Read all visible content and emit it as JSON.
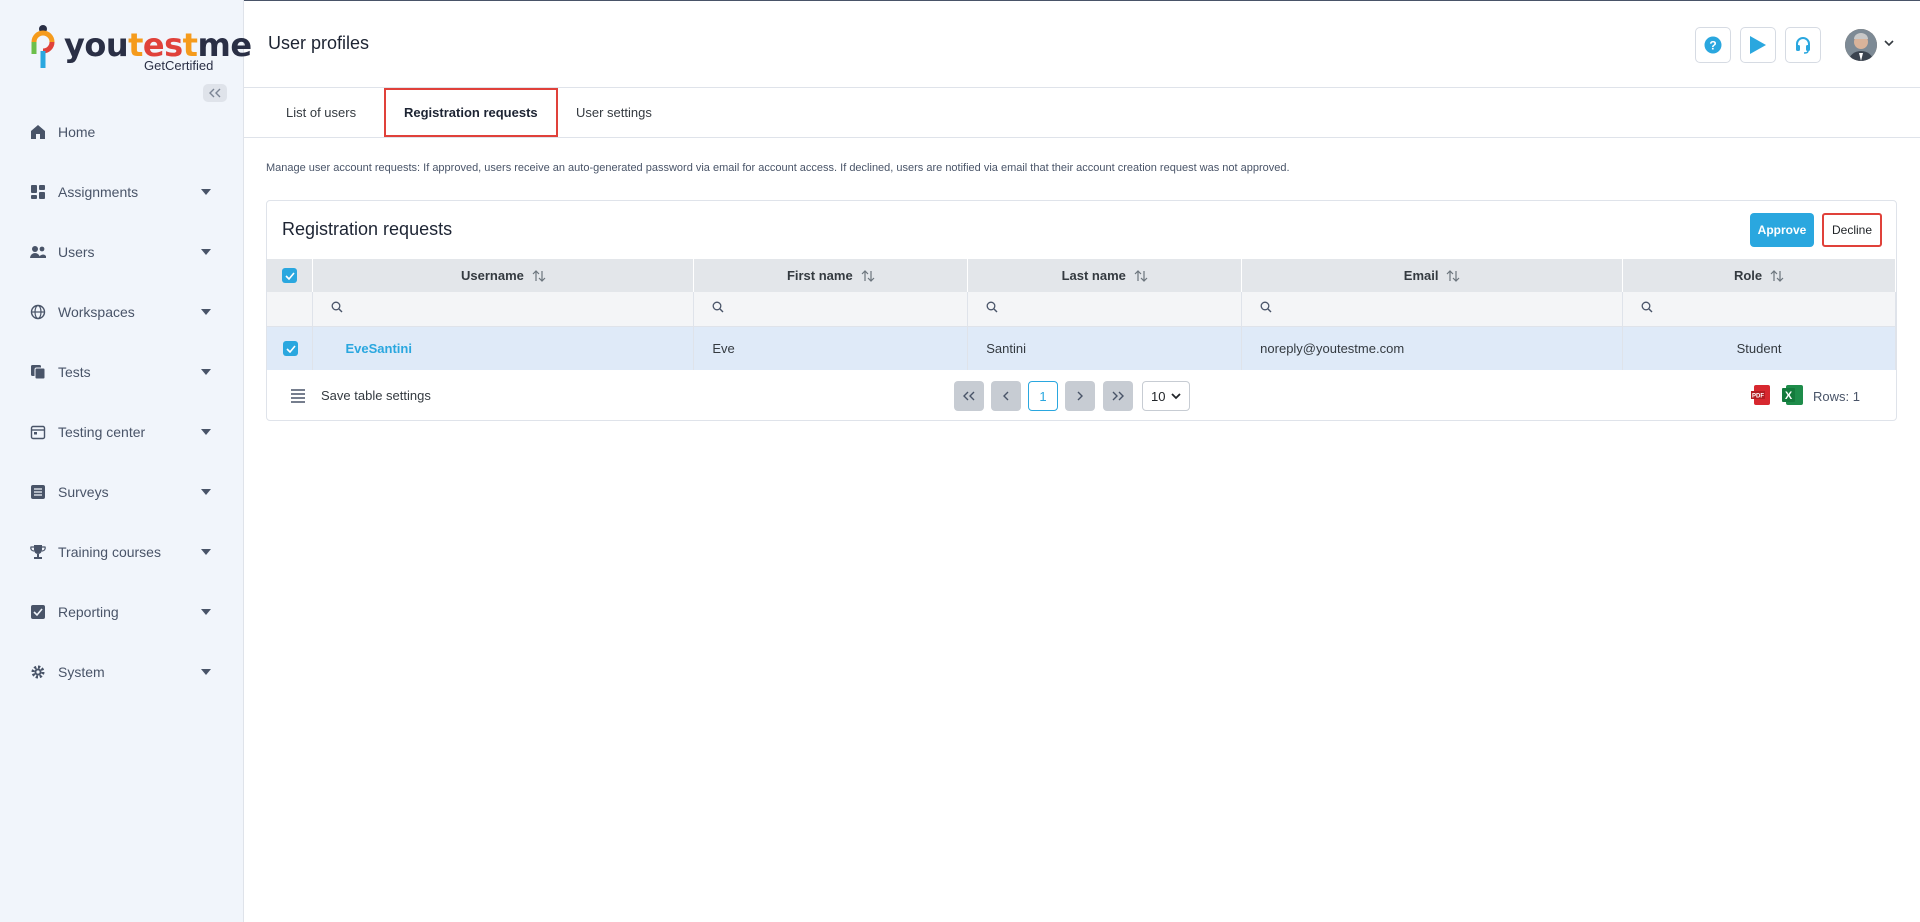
{
  "brand": {
    "name_you": "you",
    "name_t": "t",
    "name_es": "es",
    "name_t2": "t",
    "name_me": "me",
    "tagline": "GetCertified"
  },
  "sidebar": {
    "items": [
      {
        "label": "Home",
        "icon": "home-icon"
      },
      {
        "label": "Assignments",
        "icon": "assignments-icon"
      },
      {
        "label": "Users",
        "icon": "users-icon"
      },
      {
        "label": "Workspaces",
        "icon": "globe-icon"
      },
      {
        "label": "Tests",
        "icon": "tests-icon"
      },
      {
        "label": "Testing center",
        "icon": "calendar-icon"
      },
      {
        "label": "Surveys",
        "icon": "list-icon"
      },
      {
        "label": "Training courses",
        "icon": "trophy-icon"
      },
      {
        "label": "Reporting",
        "icon": "report-icon"
      },
      {
        "label": "System",
        "icon": "gear-icon"
      }
    ]
  },
  "header": {
    "title": "User profiles"
  },
  "tabs": [
    {
      "label": "List of users"
    },
    {
      "label": "Registration requests"
    },
    {
      "label": "User settings"
    }
  ],
  "info_text": "Manage user account requests: If approved, users receive an auto-generated password via email for account access. If declined, users are notified via email that their account creation request was not approved.",
  "card": {
    "title": "Registration requests",
    "approve_label": "Approve",
    "decline_label": "Decline"
  },
  "table": {
    "columns": [
      "Username",
      "First name",
      "Last name",
      "Email",
      "Role"
    ],
    "rows": [
      {
        "username": "EveSantini",
        "first_name": "Eve",
        "last_name": "Santini",
        "email": "noreply@youtestme.com",
        "role": "Student",
        "selected": true
      }
    ]
  },
  "footer": {
    "save_label": "Save table settings",
    "current_page": "1",
    "rows_per_page": "10",
    "rows_count": "Rows: 1"
  },
  "colors": {
    "accent": "#2aa7df",
    "highlight": "#e0413a",
    "sidebar_bg": "#f1f5fb"
  }
}
